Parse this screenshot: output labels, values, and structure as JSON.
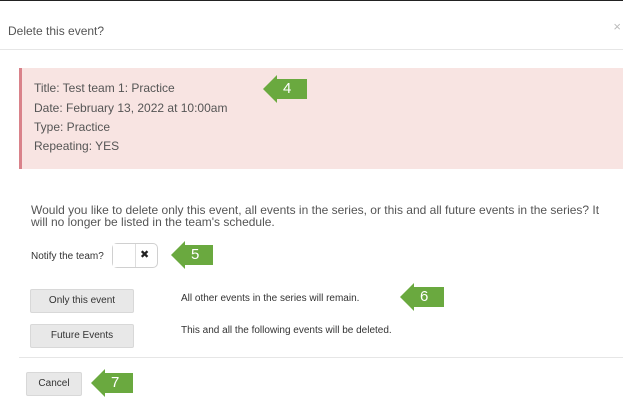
{
  "dialog": {
    "title": "Delete this event?",
    "close_glyph": "×"
  },
  "event": {
    "title_line": "Title: Test team 1: Practice",
    "date_line": "Date: February 13, 2022 at 10:00am",
    "type_line": "Type: Practice",
    "repeating_line": "Repeating: YES"
  },
  "question": "Would you like to delete only this event, all events in the series, or this and all future events in the series? It will no longer be listed in the team's schedule.",
  "notify": {
    "label": "Notify the team?",
    "toggle_state": "off",
    "toggle_glyph": "✖"
  },
  "actions": {
    "only_this": {
      "label": "Only this event",
      "description": "All other events in the series will remain."
    },
    "future": {
      "label": "Future Events",
      "description": "This and all the following events will be deleted."
    }
  },
  "footer": {
    "cancel_label": "Cancel"
  },
  "callouts": [
    "4",
    "5",
    "6",
    "7"
  ],
  "colors": {
    "info_bg": "#f8e4e2",
    "info_border": "#d9828a",
    "callout_green": "#6aa93f",
    "button_bg": "#e8e8e8"
  }
}
